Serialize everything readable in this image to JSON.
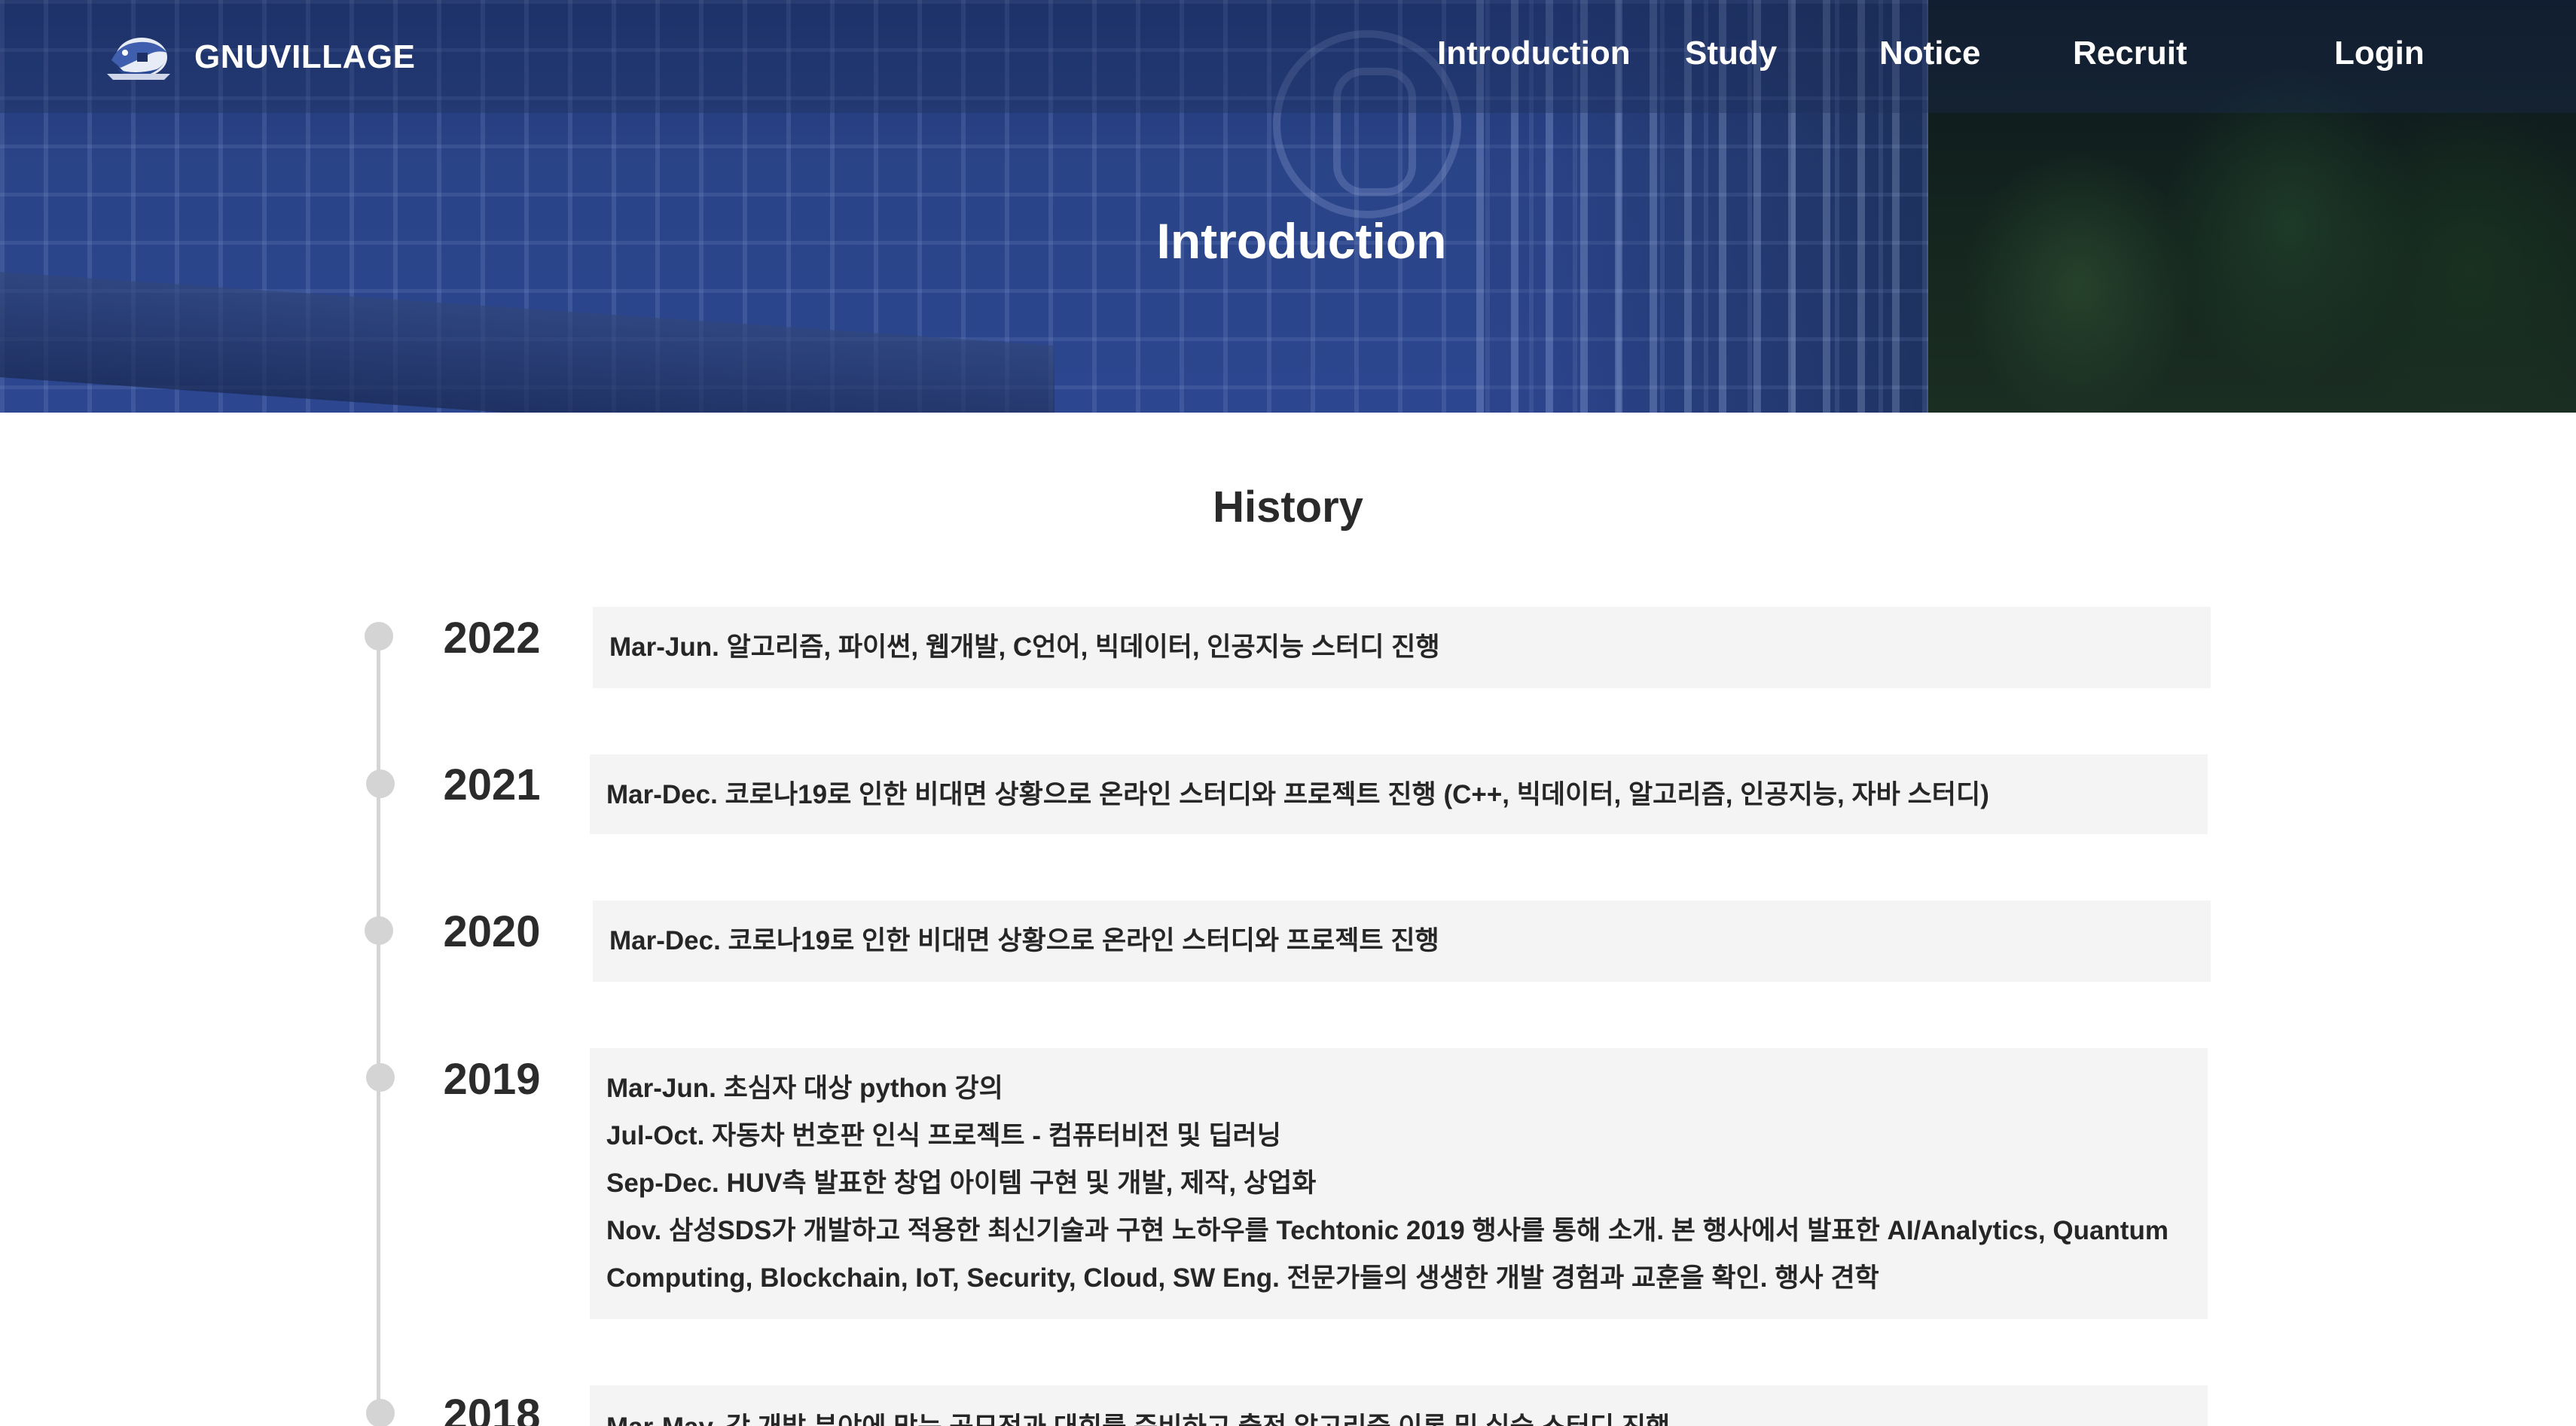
{
  "brand": {
    "name": "GNUVILLAGE",
    "logo_icon": "gnuvillage-logo-icon"
  },
  "nav": {
    "items": [
      {
        "label": "Introduction"
      },
      {
        "label": "Study"
      },
      {
        "label": "Notice"
      },
      {
        "label": "Recruit"
      }
    ],
    "login": "Login"
  },
  "hero": {
    "title": "Introduction"
  },
  "history": {
    "title": "History",
    "entries": [
      {
        "year": "2022",
        "lines": [
          "Mar-Jun. 알고리즘, 파이썬, 웹개발, C언어, 빅데이터, 인공지능 스터디 진행"
        ]
      },
      {
        "year": "2021",
        "lines": [
          "Mar-Dec. 코로나19로 인한 비대면 상황으로 온라인 스터디와 프로젝트 진행 (C++, 빅데이터, 알고리즘, 인공지능, 자바 스터디)"
        ]
      },
      {
        "year": "2020",
        "lines": [
          "Mar-Dec. 코로나19로 인한 비대면 상황으로 온라인 스터디와 프로젝트 진행"
        ]
      },
      {
        "year": "2019",
        "lines": [
          "Mar-Jun. 초심자 대상 python 강의",
          "Jul-Oct. 자동차 번호판 인식 프로젝트 - 컴퓨터비전 및 딥러닝",
          "Sep-Dec. HUV측 발표한 창업 아이템 구현 및 개발, 제작, 상업화",
          "Nov. 삼성SDS가 개발하고 적용한 최신기술과 구현 노하우를 Techtonic 2019 행사를 통해 소개. 본 행사에서 발표한 AI/Analytics, Quantum",
          "Computing, Blockchain, IoT, Security, Cloud, SW Eng. 전문가들의 생생한 개발 경험과 교훈을 확인. 행사 견학"
        ]
      },
      {
        "year": "2018",
        "lines": [
          "Mar-May. 각 개발 분야에 맞는 공모전과 대회를 준비하고 출전 알고리즘 이론 및 실습 스터디 진행"
        ]
      }
    ]
  }
}
